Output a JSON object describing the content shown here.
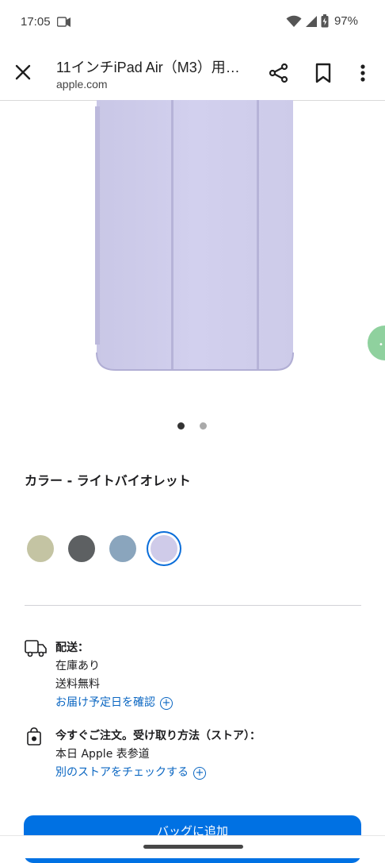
{
  "status_bar": {
    "time": "17:05",
    "battery": "97%"
  },
  "toolbar": {
    "title": "11インチiPad Air（M3）用…",
    "url": "apple.com"
  },
  "gallery": {
    "page_count": 2,
    "active_page": 1
  },
  "color": {
    "heading": "カラー - ライトバイオレット",
    "swatches": [
      "#c4c4a3",
      "#5d6062",
      "#8aa5bd",
      "#cfcbe9"
    ],
    "selected_index": 3
  },
  "delivery": {
    "heading": "配送：",
    "stock": "在庫あり",
    "shipping": "送料無料",
    "link": "お届け予定日を確認"
  },
  "pickup": {
    "heading": "今すぐご注文。受け取り方法（ストア）：",
    "store": "本日 Apple 表参道",
    "link": "別のストアをチェックする"
  },
  "bag_button": {
    "label": "バッグに追加"
  },
  "colors": {
    "accent": "#0071e3",
    "link": "#0a66c2"
  }
}
